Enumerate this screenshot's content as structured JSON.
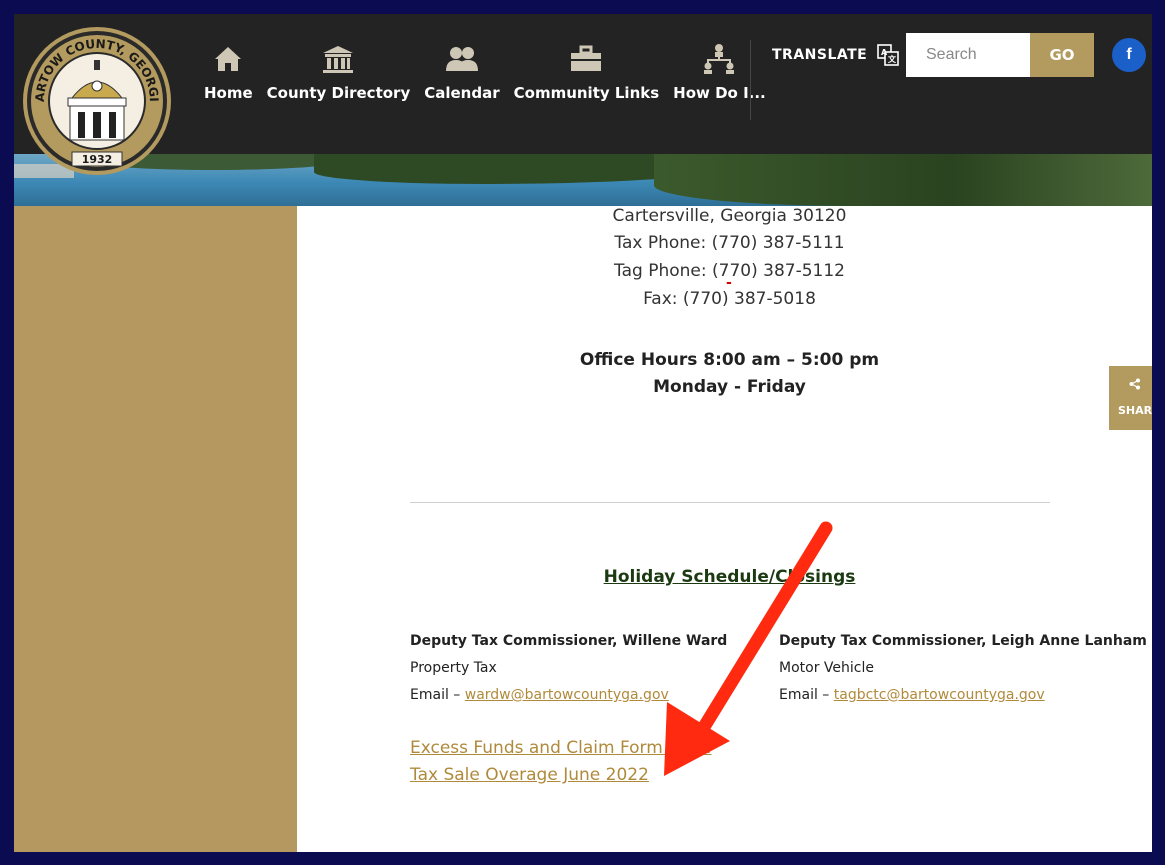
{
  "logo": {
    "arc_text": "BARTOW COUNTY, GEORGIA",
    "year": "1932"
  },
  "nav": {
    "items": [
      {
        "label": "Home",
        "icon": "home-icon"
      },
      {
        "label": "County Directory",
        "icon": "courthouse-icon"
      },
      {
        "label": "Calendar",
        "icon": "people-icon"
      },
      {
        "label": "Community Links",
        "icon": "briefcase-icon"
      },
      {
        "label": "How Do I...",
        "icon": "org-chart-icon"
      }
    ],
    "translate_label": "TRANSLATE"
  },
  "search": {
    "placeholder": "Search",
    "go_label": "GO"
  },
  "social": {
    "facebook_label": "f"
  },
  "share": {
    "label": "SHARE"
  },
  "office": {
    "address_line": "Cartersville, Georgia 30120",
    "tax_phone": "Tax Phone: (770) 387-5111",
    "tag_phone": "Tag Phone: (770) 387-5112",
    "fax": "Fax: (770) 387-5018",
    "hours": "Office Hours 8:00 am – 5:00 pm",
    "days": "Monday - Friday",
    "separator": "-"
  },
  "holiday_link": "Holiday Schedule/Closings",
  "contacts": [
    {
      "name": "Deputy Tax Commissioner, Willene Ward",
      "dept": "Property Tax",
      "email_prefix": "Email – ",
      "email": "wardw@bartowcountyga.gov"
    },
    {
      "name": "Deputy Tax Commissioner, Leigh Anne Lanham",
      "dept": "Motor Vehicle",
      "email_prefix": "Email – ",
      "email": "tagbctc@bartowcountyga.gov"
    }
  ],
  "links": {
    "excess_funds": "Excess Funds and Claim Form 2022",
    "overage": "Tax Sale Overage June 2022"
  },
  "colors": {
    "accent": "#b39a5e",
    "sidebar": "#b4985f",
    "header": "#232323",
    "arrow": "#ff2a0f",
    "frame": "#0b0b52"
  }
}
